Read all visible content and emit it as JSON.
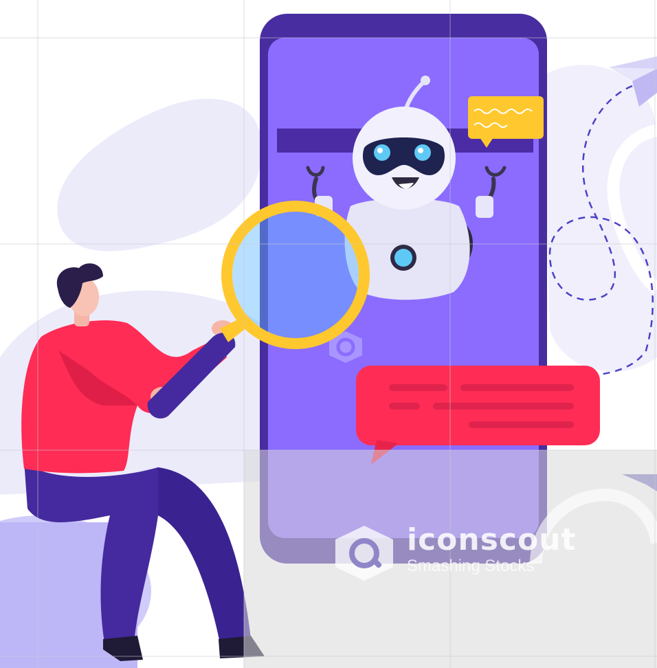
{
  "watermark": {
    "brand": "iconscout",
    "tagline": "Smashing Stocks"
  },
  "illustration": {
    "subject": "chatbot-search",
    "icons": [
      "magnifying-glass-icon",
      "paper-plane-icon",
      "chat-bubble-icon",
      "robot"
    ]
  },
  "colors": {
    "phone_frame": "#472DA0",
    "phone_screen": "#8B6CFF",
    "speech_red": "#FF2D55",
    "speech_yellow": "#FFC82E",
    "shirt_red": "#FF2C55",
    "pants_purple": "#442A9E",
    "blob_lavender": "#ECEBFA",
    "watermark_gray": "#D9D9D9"
  }
}
